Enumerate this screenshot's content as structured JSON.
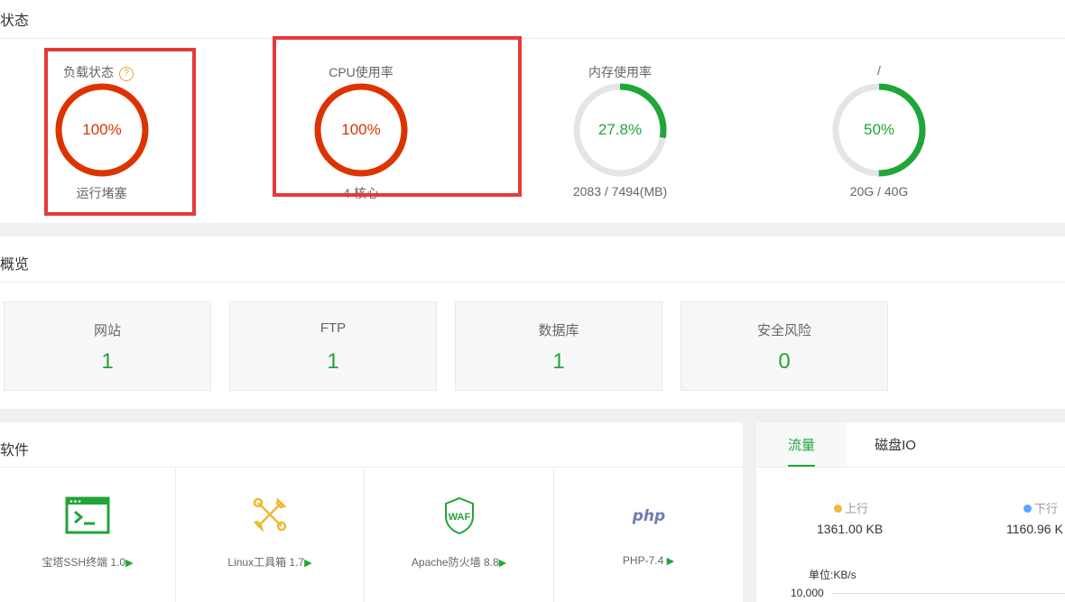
{
  "status": {
    "title": "状态",
    "gauges": [
      {
        "label": "负载状态",
        "value": "100%",
        "percent": 100,
        "sub": "运行堵塞",
        "color": "#dd3300",
        "has_help": true
      },
      {
        "label": "CPU使用率",
        "value": "100%",
        "percent": 100,
        "sub": "4 核心",
        "color": "#dd3300",
        "has_help": false
      },
      {
        "label": "内存使用率",
        "value": "27.8%",
        "percent": 27.8,
        "sub": "2083 / 7494(MB)",
        "color": "#20a53a",
        "has_help": false
      },
      {
        "label": "/",
        "value": "50%",
        "percent": 50,
        "sub": "20G / 40G",
        "color": "#20a53a",
        "has_help": false
      }
    ],
    "help_icon": "?"
  },
  "overview": {
    "title": "概览",
    "cards": [
      {
        "label": "网站",
        "value": "1"
      },
      {
        "label": "FTP",
        "value": "1"
      },
      {
        "label": "数据库",
        "value": "1"
      },
      {
        "label": "安全风险",
        "value": "0"
      }
    ]
  },
  "software": {
    "title": "软件",
    "arrow": "▶",
    "items": [
      {
        "label": "宝塔SSH终端 1.0",
        "icon": "terminal-icon"
      },
      {
        "label": "Linux工具箱 1.7",
        "icon": "tools-icon"
      },
      {
        "label": "Apache防火墙 8.8",
        "icon": "waf-shield-icon"
      },
      {
        "label": "PHP-7.4",
        "icon": "php-logo-icon"
      }
    ]
  },
  "traffic": {
    "tabs": [
      "流量",
      "磁盘IO"
    ],
    "up_label": "上行",
    "up_value": "1361.00 KB",
    "up_color": "#f0b840",
    "down_label": "下行",
    "down_value": "1160.96 K",
    "down_color": "#52a9ff",
    "unit": "单位:KB/s",
    "y_tick": "10,000"
  },
  "colors": {
    "accent": "#20a53a",
    "danger": "#dd3300",
    "highlight": "#e53a3a"
  }
}
